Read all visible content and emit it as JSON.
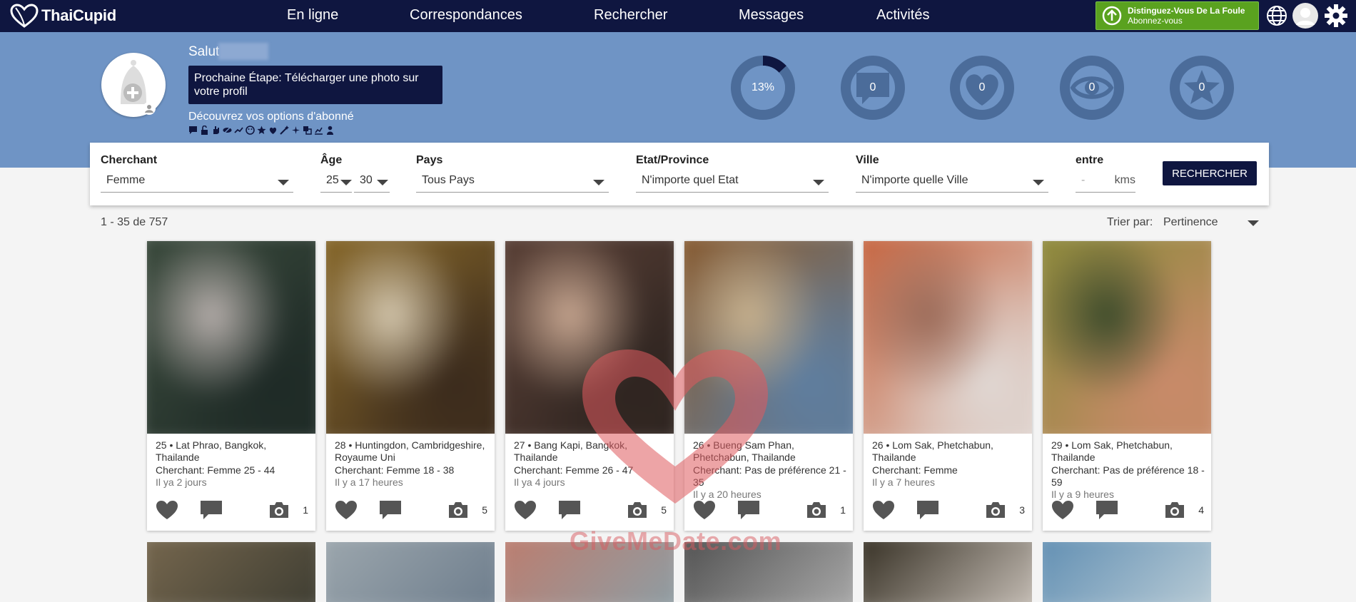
{
  "brand": {
    "name_a": "Thai",
    "name_b": "Cupid"
  },
  "nav": [
    {
      "id": "online",
      "label": "En ligne"
    },
    {
      "id": "matches",
      "label": "Correspondances"
    },
    {
      "id": "search",
      "label": "Rechercher"
    },
    {
      "id": "messages",
      "label": "Messages"
    },
    {
      "id": "activity",
      "label": "Activités"
    }
  ],
  "upgrade": {
    "title": "Distinguez-Vous De La Foule",
    "subtitle": "Abonnez-vous"
  },
  "profile": {
    "greeting": "Salut",
    "next_step": "Prochaine Étape: Télécharger une photo sur votre profil",
    "discover": "Découvrez vos options d'abonné"
  },
  "stats": [
    {
      "name": "completion",
      "value": "13%",
      "fraction": 0.13
    },
    {
      "name": "messages",
      "value": "0"
    },
    {
      "name": "likes",
      "value": "0"
    },
    {
      "name": "views",
      "value": "0"
    },
    {
      "name": "favorites",
      "value": "0"
    }
  ],
  "search": {
    "seeking_label": "Cherchant",
    "seeking_value": "Femme",
    "age_label": "Âge",
    "age_min": "25",
    "age_max": "30",
    "country_label": "Pays",
    "country_value": "Tous Pays",
    "state_label": "Etat/Province",
    "state_value": "N'importe quel Etat",
    "city_label": "Ville",
    "city_value": "N'importe quelle Ville",
    "distance_label": "entre",
    "distance_value": "-",
    "distance_unit": "kms",
    "button": "RECHERCHER"
  },
  "results": {
    "count": "1 - 35 de 757",
    "sort_label": "Trier par:",
    "sort_value": "Pertinence"
  },
  "cards": [
    {
      "loc": "25 • Lat Phrao, Bangkok, Thailande",
      "seek": "Cherchant: Femme 25 - 44",
      "time": "Il ya 2 jours",
      "photos": "1",
      "colors": [
        "#3a4a3c",
        "#1e2a26",
        "#b8b0ad"
      ]
    },
    {
      "loc": "28 • Huntingdon, Cambridgeshire, Royaume Uni",
      "seek": "Cherchant: Femme 18 - 38",
      "time": "Il y a 17 heures",
      "photos": "5",
      "colors": [
        "#8a6a2a",
        "#3a2a1c",
        "#d6c9b0"
      ]
    },
    {
      "loc": "27 • Bang Kapi, Bangkok, Thailande",
      "seek": "Cherchant: Femme 26 - 47",
      "time": "Il ya 4 jours",
      "photos": "5",
      "colors": [
        "#5a4036",
        "#2e2420",
        "#c9a892"
      ]
    },
    {
      "loc": "26 • Bueng Sam Phan, Phetchabun, Thailande",
      "seek": "Cherchant: Pas de préférence 21 - 35",
      "time": "Il y a 20 heures",
      "photos": "1",
      "colors": [
        "#8a5a2c",
        "#5e7ea0",
        "#c9b28e"
      ]
    },
    {
      "loc": "26 • Lom Sak, Phetchabun, Thailande",
      "seek": "Cherchant: Femme",
      "time": "Il y a 7 heures",
      "photos": "3",
      "colors": [
        "#c5603a",
        "#e0d8d4",
        "#9a6a58"
      ]
    },
    {
      "loc": "29 • Lom Sak, Phetchabun, Thailande",
      "seek": "Cherchant: Pas de préférence 18 - 59",
      "time": "Il y a 9 heures",
      "photos": "4",
      "colors": [
        "#8a8a3a",
        "#c98a6a",
        "#3a4a2a"
      ]
    }
  ],
  "row2_colors": [
    [
      "#7a6a50",
      "#3a3a30"
    ],
    [
      "#a0aab0",
      "#6a7a8a"
    ],
    [
      "#c07a6a",
      "#8aa0a8"
    ],
    [
      "#4a4a4a",
      "#b0b0b0"
    ],
    [
      "#2a2418",
      "#d0c8c0"
    ],
    [
      "#5a8ab0",
      "#c0d0d8"
    ]
  ],
  "watermark": "GiveMeDate.com",
  "theme": {
    "navy": "#0f1640",
    "band": "#6f94c5",
    "green": "#5aa21f"
  }
}
